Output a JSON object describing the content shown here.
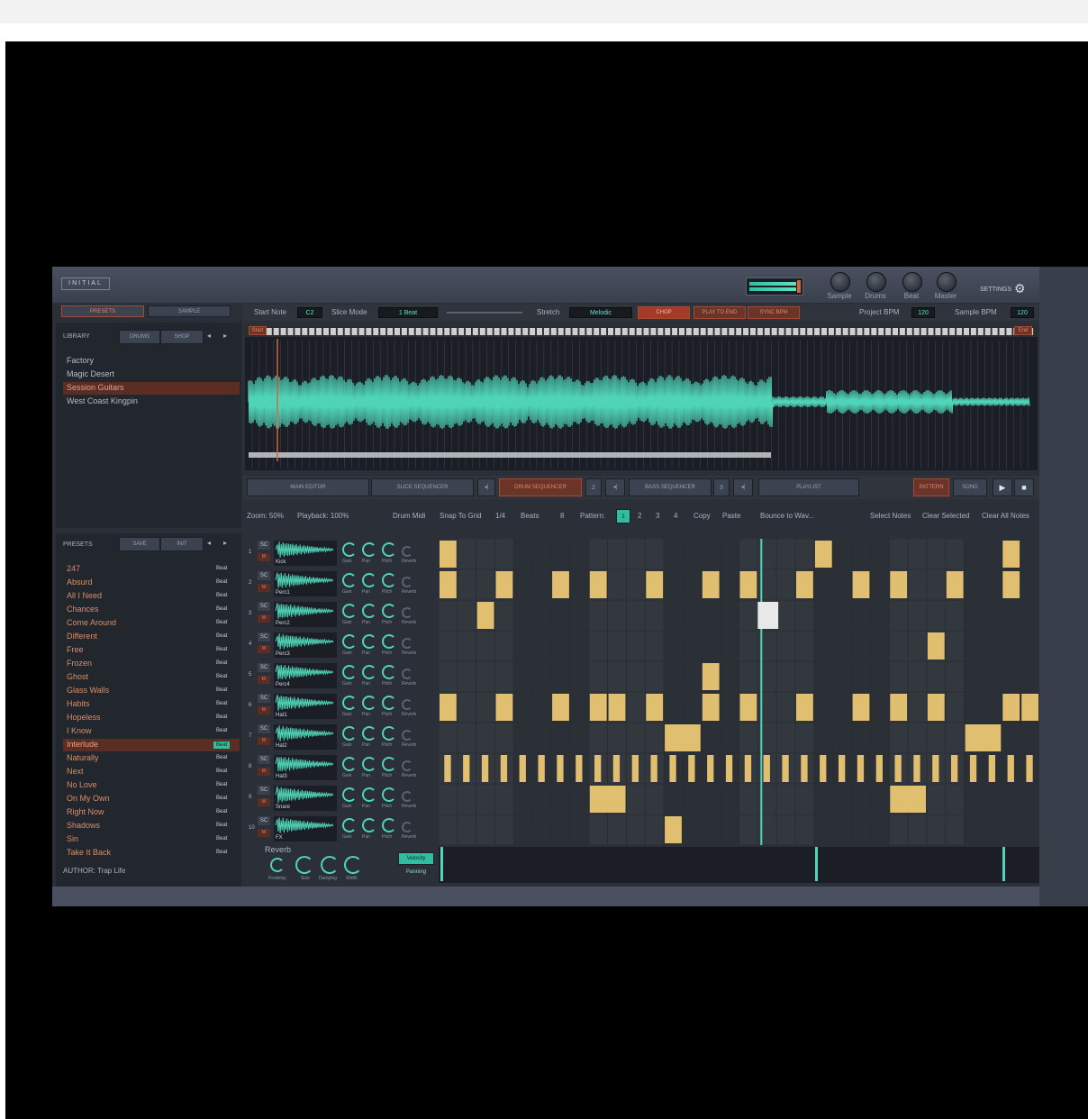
{
  "app": {
    "logo": "INITIAL",
    "settings_label": "SETTINGS",
    "knobs": [
      "Sample",
      "Drums",
      "Beat",
      "Master"
    ]
  },
  "left": {
    "tabs": [
      "PRESETS",
      "SAMPLE"
    ],
    "library_label": "LIBRARY",
    "library_filters": [
      "DRUMS",
      "SHOP"
    ],
    "library_items": [
      "Factory",
      "Magic Desert",
      "Session Guitars",
      "West Coast Kingpin"
    ],
    "library_selected": 2,
    "presets_label": "PRESETS",
    "presets_buttons": [
      "SAVE",
      "INIT"
    ],
    "presets": [
      "247",
      "Absurd",
      "All I Need",
      "Chances",
      "Come Around",
      "Different",
      "Free",
      "Frozen",
      "Ghost",
      "Glass Walls",
      "Habits",
      "Hopeless",
      "I Know",
      "Interlude",
      "Naturally",
      "Next",
      "No Love",
      "On My Own",
      "Right Now",
      "Shadows",
      "Sin",
      "Take It Back"
    ],
    "preset_tag": "Beat",
    "presets_selected": 13,
    "author": "AUTHOR: Trap Life"
  },
  "toolbar": {
    "start_note_label": "Start Note",
    "start_note": "C2",
    "slice_mode_label": "Slice Mode",
    "slice_mode": "1 Beat",
    "stretch_label": "Stretch",
    "stretch": "Melodic",
    "chop": "CHOP",
    "play_to_end": "PLAY TO END",
    "sync_bpm": "SYNC BPM",
    "project_bpm_label": "Project BPM",
    "project_bpm": "120",
    "sample_bpm_label": "Sample BPM",
    "sample_bpm": "120"
  },
  "waveform": {
    "start_marker": "Start",
    "end_marker": "End"
  },
  "modes": {
    "main_editor": "MAIN EDITOR",
    "slice_sequencer": "SLICE SEQUENCER",
    "drum_sequencer": "DRUM SEQUENCER",
    "drum_count": "2",
    "bass_sequencer": "BASS SEQUENCER",
    "bass_count": "3",
    "playlist": "PLAYLIST",
    "pattern": "PATTERN",
    "song": "SONG"
  },
  "seq_toolbar": {
    "zoom": "Zoom: 50%",
    "playback": "Playback: 100%",
    "drum_midi": "Drum Midi",
    "snap": "Snap To Grid",
    "snap_val": "1/4",
    "beats": "Beats",
    "beats_val": "8",
    "pattern": "Pattern:",
    "patterns": [
      "1",
      "2",
      "3",
      "4"
    ],
    "copy": "Copy",
    "paste": "Paste",
    "bounce": "Bounce to Wav...",
    "select_notes": "Select Notes",
    "clear_selected": "Clear Selected",
    "clear_all": "Clear All Notes"
  },
  "tracks": [
    {
      "num": "1",
      "name": "Kick"
    },
    {
      "num": "2",
      "name": "Perc1"
    },
    {
      "num": "3",
      "name": "Perc2"
    },
    {
      "num": "4",
      "name": "Perc3"
    },
    {
      "num": "5",
      "name": "Perc4"
    },
    {
      "num": "6",
      "name": "Hat1"
    },
    {
      "num": "7",
      "name": "Hat2"
    },
    {
      "num": "8",
      "name": "Hat3"
    },
    {
      "num": "9",
      "name": "Snare"
    },
    {
      "num": "10",
      "name": "FX"
    }
  ],
  "track_knob_labels": [
    "Gain",
    "Pan",
    "Pitch",
    "Reverb"
  ],
  "sc_label": "SC",
  "mute_label": "M",
  "reverb": {
    "title": "Reverb",
    "knobs": [
      "Predelay",
      "Size",
      "Damping",
      "Width"
    ]
  },
  "lanes": {
    "velocity": "Velocity",
    "panning": "Panning"
  },
  "colors": {
    "accent": "#4fd4b8",
    "note": "#e0c070",
    "alert": "#d4643a",
    "bg": "#2b3038"
  }
}
